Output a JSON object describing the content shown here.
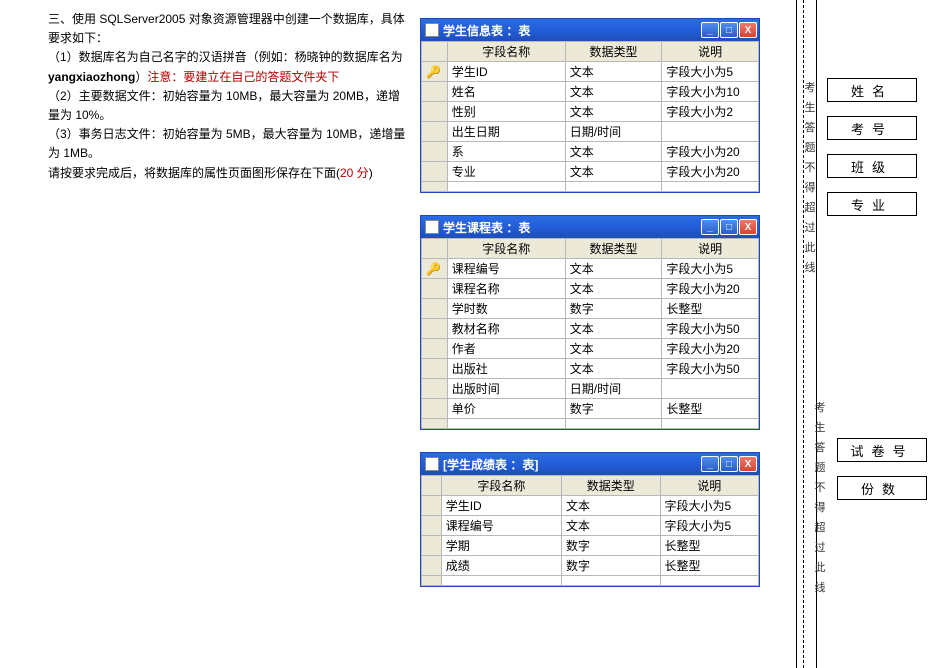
{
  "question": {
    "heading": "三、使用 SQLServer2005 对象资源管理器中创建一个数据库，具体要求如下：",
    "p1a": "（1）数据库名为自己名字的汉语拼音（例如：杨晓钟的数据库名为 ",
    "p1b": "yangxiaozhong",
    "p1c": "）",
    "p1red": "注意：要建立在自己的答题文件夹下",
    "p1d": "",
    "p2": "（2）主要数据文件：初始容量为 10MB，最大容量为 20MB，递增量为 10%。",
    "p3": "（3）事务日志文件：初始容量为 5MB，最大容量为 10MB，递增量为 1MB。",
    "finish_a": "请按要求完成后，将数据库的属性页面图形保存在下面(",
    "score_red": "20 分",
    "finish_b": ")"
  },
  "headers": {
    "field": "字段名称",
    "type": "数据类型",
    "desc": "说明"
  },
  "win1": {
    "title": "学生信息表 ：表",
    "rows": [
      {
        "pk": true,
        "name": "学生ID",
        "type": "文本",
        "desc": "字段大小为5"
      },
      {
        "pk": false,
        "name": "姓名",
        "type": "文本",
        "desc": "字段大小为10"
      },
      {
        "pk": false,
        "name": "性别",
        "type": "文本",
        "desc": "字段大小为2"
      },
      {
        "pk": false,
        "name": "出生日期",
        "type": "日期/时间",
        "desc": ""
      },
      {
        "pk": false,
        "name": "系",
        "type": "文本",
        "desc": "字段大小为20"
      },
      {
        "pk": false,
        "name": "专业",
        "type": "文本",
        "desc": "字段大小为20"
      }
    ]
  },
  "win2": {
    "title": "学生课程表 ：表",
    "rows": [
      {
        "pk": true,
        "name": "课程编号",
        "type": "文本",
        "desc": "字段大小为5"
      },
      {
        "pk": false,
        "name": "课程名称",
        "type": "文本",
        "desc": "字段大小为20"
      },
      {
        "pk": false,
        "name": "学时数",
        "type": "数字",
        "desc": "长整型"
      },
      {
        "pk": false,
        "name": "教材名称",
        "type": "文本",
        "desc": "字段大小为50"
      },
      {
        "pk": false,
        "name": "作者",
        "type": "文本",
        "desc": "字段大小为20"
      },
      {
        "pk": false,
        "name": "出版社",
        "type": "文本",
        "desc": "字段大小为50"
      },
      {
        "pk": false,
        "name": "出版时间",
        "type": "日期/时间",
        "desc": ""
      },
      {
        "pk": false,
        "name": "单价",
        "type": "数字",
        "desc": "长整型"
      }
    ]
  },
  "win3": {
    "title": "[学生成绩表 ：表]",
    "rows": [
      {
        "pk": false,
        "name": "学生ID",
        "type": "文本",
        "desc": "字段大小为5"
      },
      {
        "pk": false,
        "name": "课程编号",
        "type": "文本",
        "desc": "字段大小为5"
      },
      {
        "pk": false,
        "name": "学期",
        "type": "数字",
        "desc": "长整型"
      },
      {
        "pk": false,
        "name": "成绩",
        "type": "数字",
        "desc": "长整型"
      }
    ]
  },
  "margin_vtext": [
    "考",
    "生",
    "答",
    "题",
    "不",
    "得",
    "超",
    "过",
    "此",
    "线"
  ],
  "info_boxes_top": [
    "姓名",
    "考号",
    "班级",
    "专业"
  ],
  "info_boxes_bottom": [
    "试卷号",
    "份数"
  ],
  "btn": {
    "min": "_",
    "max": "□",
    "close": "X"
  }
}
